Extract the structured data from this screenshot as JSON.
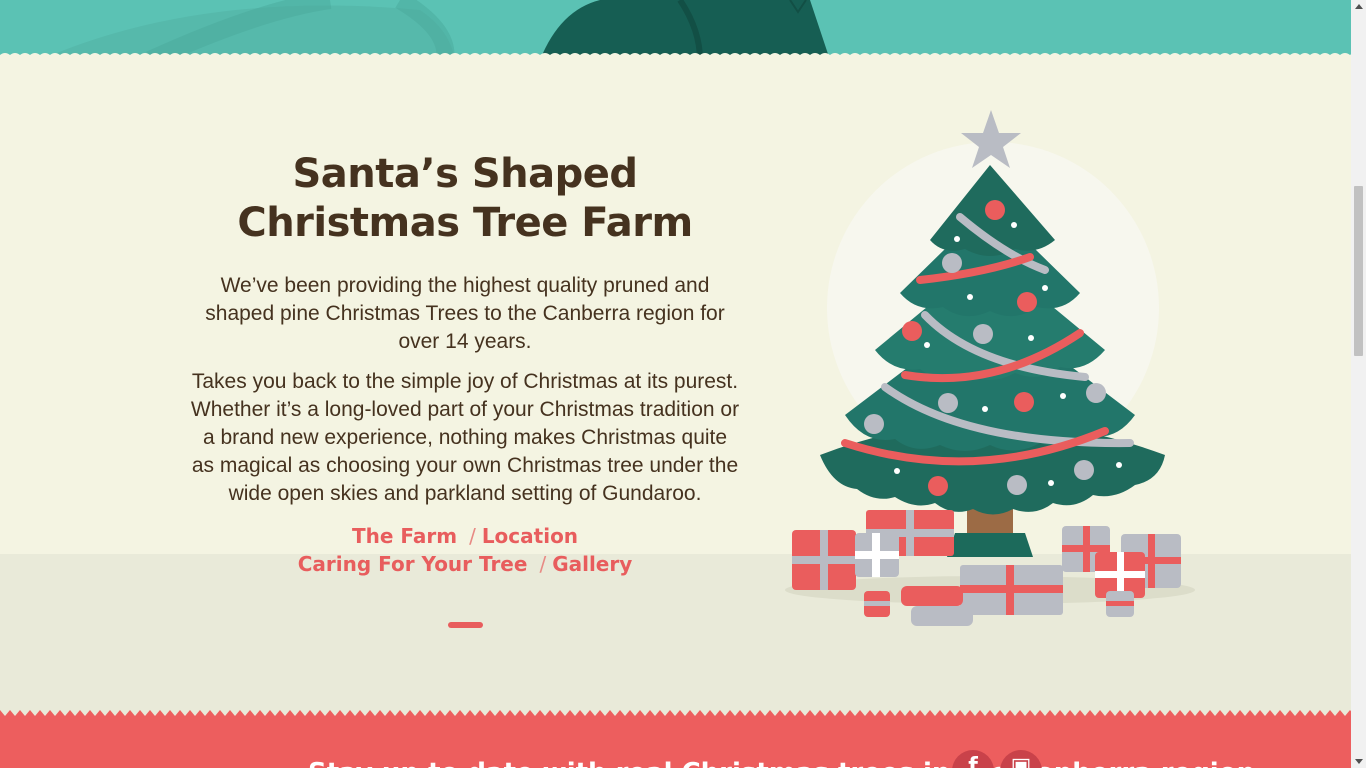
{
  "intro": {
    "title": "Santa’s Shaped Christmas Tree Farm",
    "paragraph_1": "We’ve been providing the highest quality pruned and shaped pine Christmas Trees to the Canberra region for over 14 years.",
    "paragraph_2": "Takes you back to the simple joy of Christmas at its purest. Whether it’s a long-loved part of your Christmas tradition or a brand new experience, nothing makes Christmas quite as magical as choosing your own Christmas tree under the wide open skies and parkland setting of Gundaroo.",
    "links": [
      {
        "label": "The Farm"
      },
      {
        "label": "Location"
      },
      {
        "label": "Caring For Your Tree"
      },
      {
        "label": "Gallery"
      }
    ],
    "link_separator": "/"
  },
  "footer": {
    "text": "Stay up to date with real Christmas trees in the Canberra region",
    "social": {
      "facebook_icon": "facebook-icon",
      "instagram_icon": "instagram-icon"
    }
  },
  "colors": {
    "background": "#f4f4e2",
    "heading": "#45321f",
    "accent": "#e85d5d",
    "teal": "#5bc2b4",
    "tree_green": "#1e6b5c",
    "footer": "#ed5e5e"
  },
  "icons": {
    "tree": "christmas-tree-illustration",
    "star": "star-icon",
    "gift": "gift-icon"
  }
}
